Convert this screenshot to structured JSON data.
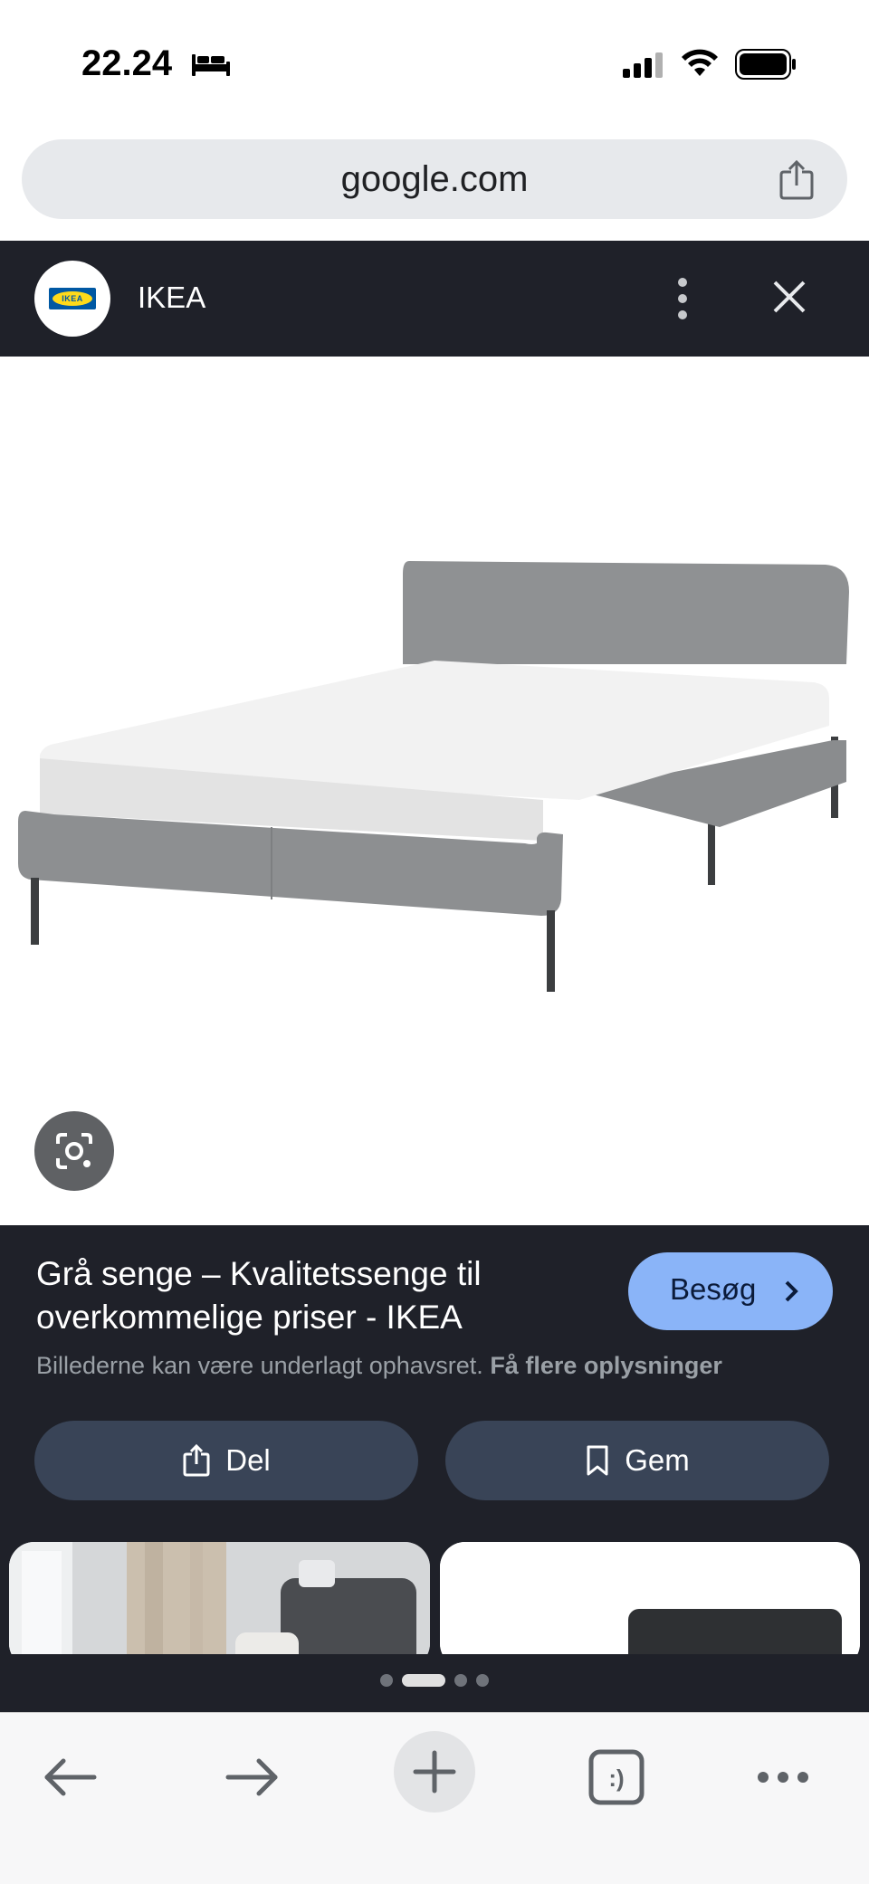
{
  "status_bar": {
    "time": "22.24",
    "bed_icon": "bed-icon",
    "signal_icon": "cellular-signal-icon",
    "wifi_icon": "wifi-icon",
    "battery_icon": "battery-icon"
  },
  "browser": {
    "url": "google.com",
    "share_icon": "share-icon"
  },
  "overlay_header": {
    "site_name": "IKEA",
    "logo_text": "IKEA",
    "more_icon": "more-vert-icon",
    "close_icon": "close-icon"
  },
  "image": {
    "description_icon": "bed-product-image",
    "lens_icon": "google-lens-icon"
  },
  "result": {
    "title": "Grå senge – Kvalitetssenge til overkommelige priser - IKEA",
    "visit_label": "Besøg",
    "copyright_text": "Billederne kan være underlagt ophavsret.",
    "copyright_link": "Få flere oplysninger",
    "share_label": "Del",
    "save_label": "Gem"
  },
  "pager": {
    "count": 4,
    "active_index": 1
  },
  "toolbar": {
    "back_icon": "arrow-left-icon",
    "forward_icon": "arrow-right-icon",
    "new_tab_icon": "plus-icon",
    "tabs_icon": "tabs-icon",
    "tabs_glyph": ":)",
    "menu_icon": "more-horiz-icon"
  },
  "colors": {
    "panel_bg": "#1f2129",
    "accent_blue": "#8ab4f8",
    "button_bg": "#394457"
  }
}
